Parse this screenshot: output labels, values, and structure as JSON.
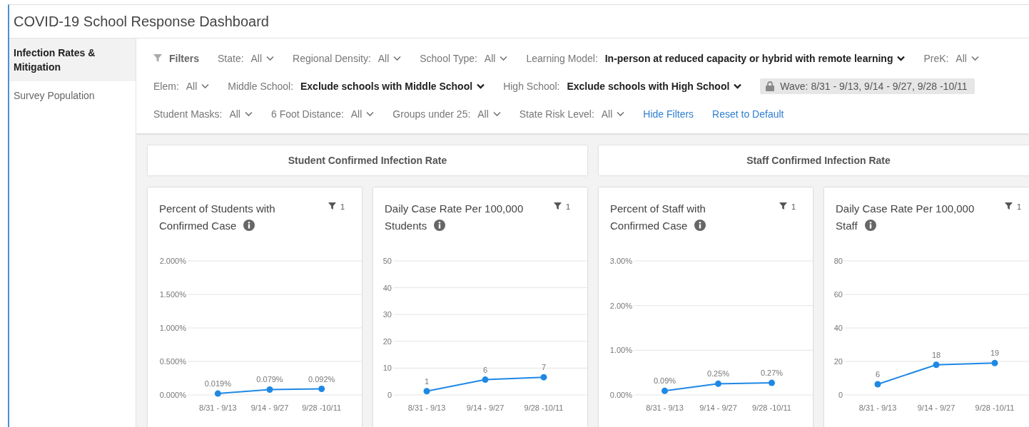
{
  "title": "COVID-19 School Response Dashboard",
  "sidebar": {
    "items": [
      {
        "label": "Infection Rates & Mitigation",
        "selected": true
      },
      {
        "label": "Survey Population",
        "selected": false
      }
    ]
  },
  "filters": {
    "heading": "Filters",
    "rows": [
      {
        "items": [
          {
            "kind": "dropdown",
            "label": "State:",
            "value": "All",
            "highlighted": false
          },
          {
            "kind": "dropdown",
            "label": "Regional Density:",
            "value": "All",
            "highlighted": false
          },
          {
            "kind": "dropdown",
            "label": "School Type:",
            "value": "All",
            "highlighted": false
          },
          {
            "kind": "dropdown",
            "label": "Learning Model:",
            "value": "In-person at reduced capacity or hybrid with remote learning",
            "highlighted": true
          },
          {
            "kind": "dropdown",
            "label": "PreK:",
            "value": "All",
            "highlighted": false
          }
        ]
      },
      {
        "items": [
          {
            "kind": "dropdown",
            "label": "Elem:",
            "value": "All",
            "highlighted": false
          },
          {
            "kind": "dropdown",
            "label": "Middle School:",
            "value": "Exclude schools with Middle School",
            "highlighted": true
          },
          {
            "kind": "dropdown",
            "label": "High School:",
            "value": "Exclude schools with High School",
            "highlighted": true
          },
          {
            "kind": "locked",
            "label": "Wave:",
            "value": "8/31 - 9/13, 9/14 - 9/27, 9/28 -10/11"
          }
        ]
      },
      {
        "items": [
          {
            "kind": "dropdown",
            "label": "Student Masks:",
            "value": "All",
            "highlighted": false
          },
          {
            "kind": "dropdown",
            "label": "6 Foot Distance:",
            "value": "All",
            "highlighted": false
          },
          {
            "kind": "dropdown",
            "label": "Groups under 25:",
            "value": "All",
            "highlighted": false
          },
          {
            "kind": "dropdown",
            "label": "State Risk Level:",
            "value": "All",
            "highlighted": false
          },
          {
            "kind": "link",
            "label": "Hide Filters"
          },
          {
            "kind": "link",
            "label": "Reset to Default"
          }
        ]
      }
    ]
  },
  "sections": [
    {
      "title": "Student Confirmed Infection Rate",
      "cards": [
        {
          "title": "Percent of Students with Confirmed Case",
          "filter_count": "1",
          "chart_data": {
            "type": "line",
            "categories": [
              "8/31 - 9/13",
              "9/14 - 9/27",
              "9/28 -10/11"
            ],
            "grid": true,
            "series": [
              {
                "color": "#1e88e5",
                "marker": true,
                "values": [
                  0.02,
                  0.08,
                  0.09
                ]
              }
            ],
            "value_labels": [
              "0.019%",
              "0.079%",
              "0.092%"
            ],
            "ylim": [
              0,
              2
            ],
            "yticks": [
              {
                "value": 0,
                "label": "0.000%"
              },
              {
                "value": 0.5,
                "label": "0.500%"
              },
              {
                "value": 1,
                "label": "1.000%"
              },
              {
                "value": 1.5,
                "label": "1.500%"
              },
              {
                "value": 2,
                "label": "2.000%"
              }
            ]
          }
        },
        {
          "title": "Daily Case Rate Per 100,000 Students",
          "filter_count": "1",
          "chart_data": {
            "type": "line",
            "categories": [
              "8/31 - 9/13",
              "9/14 - 9/27",
              "9/28 -10/11"
            ],
            "grid": true,
            "series": [
              {
                "color": "#1e88e5",
                "marker": true,
                "values": [
                  1.4,
                  5.7,
                  6.6
                ]
              }
            ],
            "value_labels": [
              "1",
              "6",
              "7"
            ],
            "ylim": [
              0,
              50
            ],
            "yticks": [
              0,
              10,
              20,
              30,
              40,
              50
            ]
          }
        }
      ]
    },
    {
      "title": "Staff Confirmed Infection Rate",
      "cards": [
        {
          "title": "Percent of Staff with Confirmed Case",
          "filter_count": "1",
          "chart_data": {
            "type": "line",
            "categories": [
              "8/31 - 9/13",
              "9/14 - 9/27",
              "9/28 -10/11"
            ],
            "grid": true,
            "series": [
              {
                "color": "#1e88e5",
                "marker": true,
                "values": [
                  0.09,
                  0.25,
                  0.27
                ]
              }
            ],
            "value_labels": [
              "0.09%",
              "0.25%",
              "0.27%"
            ],
            "ylim": [
              0,
              3
            ],
            "yticks": [
              {
                "value": 0,
                "label": "0.00%"
              },
              {
                "value": 1,
                "label": "1.00%"
              },
              {
                "value": 2,
                "label": "2.00%"
              },
              {
                "value": 3,
                "label": "3.00%"
              }
            ]
          }
        },
        {
          "title": "Daily Case Rate Per 100,000 Staff",
          "filter_count": "1",
          "chart_data": {
            "type": "line",
            "categories": [
              "8/31 - 9/13",
              "9/14 - 9/27",
              "9/28 -10/11"
            ],
            "grid": true,
            "series": [
              {
                "color": "#1e88e5",
                "marker": true,
                "values": [
                  6.4,
                  18,
                  19
                ]
              }
            ],
            "value_labels": [
              "6",
              "18",
              "19"
            ],
            "ylim": [
              0,
              80
            ],
            "yticks": [
              0,
              20,
              40,
              60,
              80
            ]
          }
        }
      ]
    }
  ]
}
